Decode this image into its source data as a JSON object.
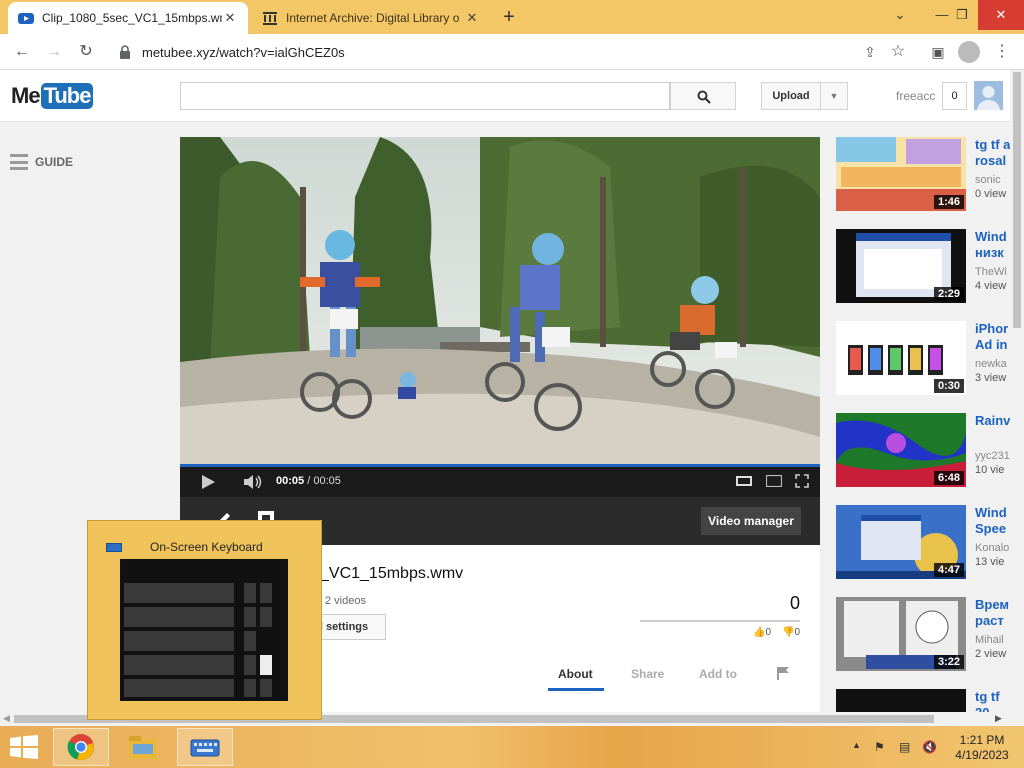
{
  "browser": {
    "tabs": [
      {
        "title": "Clip_1080_5sec_VC1_15mbps.wm",
        "active": true
      },
      {
        "title": "Internet Archive: Digital Library o",
        "active": false
      }
    ],
    "url": "metubee.xyz/watch?v=ialGhCEZ0s"
  },
  "site": {
    "logo_me": "Me",
    "logo_tube": "Tube",
    "search_placeholder": "",
    "upload_label": "Upload",
    "username": "freeacc",
    "notification_count": "0",
    "guide_label": "GUIDE"
  },
  "player": {
    "current_time": "00:05",
    "separator": "/",
    "duration": "00:05",
    "progress": 1.0
  },
  "video": {
    "title": "_VC1_15mbps.wmv",
    "channel_videos": "2 videos",
    "channel_settings_label": "nel settings",
    "video_manager_label": "Video manager",
    "views": "0",
    "likes": "0",
    "dislikes": "0",
    "tabs": [
      "About",
      "Share",
      "Add to"
    ],
    "active_tab": "About"
  },
  "related": [
    {
      "title": "tg tf a\nrosal",
      "author": "sonic",
      "views": "0 view",
      "duration": "1:46"
    },
    {
      "title": "Wind\nнизк",
      "author": "TheWi",
      "views": "4 view",
      "duration": "2:29"
    },
    {
      "title": "iPhor\nAd in",
      "author": "newka",
      "views": "3 view",
      "duration": "0:30"
    },
    {
      "title": "Rainv",
      "author": "yyc231",
      "views": "10 vie",
      "duration": "6:48"
    },
    {
      "title": "Wind\nSpee",
      "author": "Konalo",
      "views": "13 vie",
      "duration": "4:47"
    },
    {
      "title": "Врем\nраст",
      "author": "Mihail",
      "views": "2 view",
      "duration": "3:22"
    },
    {
      "title": "tg tf\n20",
      "author": "",
      "views": "",
      "duration": ""
    }
  ],
  "osk": {
    "title": "On-Screen Keyboard"
  },
  "taskbar": {
    "time": "1:21 PM",
    "date": "4/19/2023"
  },
  "colors": {
    "accent": "#1c62c0",
    "chrome_frame": "#f3c765",
    "taskbar": "#e8ad55"
  }
}
